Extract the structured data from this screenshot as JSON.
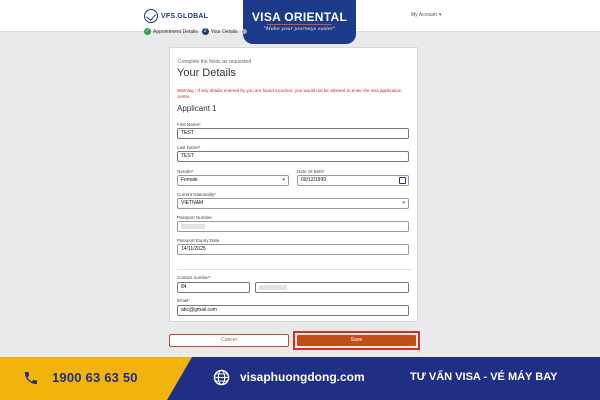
{
  "header": {
    "logo_text": "VFS.GLOBAL",
    "account_label": "My Account",
    "brand_title": "VISA ORIENTAL",
    "brand_slogan": "\"Make your journeys easier\""
  },
  "stepper": {
    "steps": [
      {
        "label": "Appointment Details",
        "state": "done"
      },
      {
        "label": "Your Details",
        "state": "current",
        "number": "2"
      }
    ]
  },
  "form": {
    "hint": "Complete the fields as requested",
    "title": "Your Details",
    "warning": "Warning : If any details entered by you are found incorrect, you would not be allowed to enter the visa application centre.",
    "applicant_heading": "Applicant 1",
    "first_name": {
      "label": "First Name*",
      "value": "TEST"
    },
    "last_name": {
      "label": "Last Name*",
      "value": "TEST"
    },
    "gender": {
      "label": "Gender*",
      "value": "Female"
    },
    "dob": {
      "label": "Date Of Birth*",
      "value": "09/12/1999"
    },
    "nationality": {
      "label": "Current Nationality*",
      "value": "VIETNAM"
    },
    "passport_number": {
      "label": "Passport Number",
      "value": ""
    },
    "passport_expiry": {
      "label": "Passport Expiry Date",
      "value": "14/11/2025"
    },
    "contact": {
      "label": "Contact number*",
      "code": "84",
      "number": ""
    },
    "email": {
      "label": "Email*",
      "value": "abc@gmail.com"
    }
  },
  "actions": {
    "cancel_label": "Cancel",
    "save_label": "Save"
  },
  "footer": {
    "phone": "1900 63 63 50",
    "website": "visaphuongdong.com",
    "tagline": "TƯ VẤN VISA - VÉ MÁY BAY"
  },
  "colors": {
    "brand_blue": "#1f2f86",
    "accent_yellow": "#f2b40c",
    "save_orange": "#c04f17",
    "warning_red": "#c62828"
  }
}
